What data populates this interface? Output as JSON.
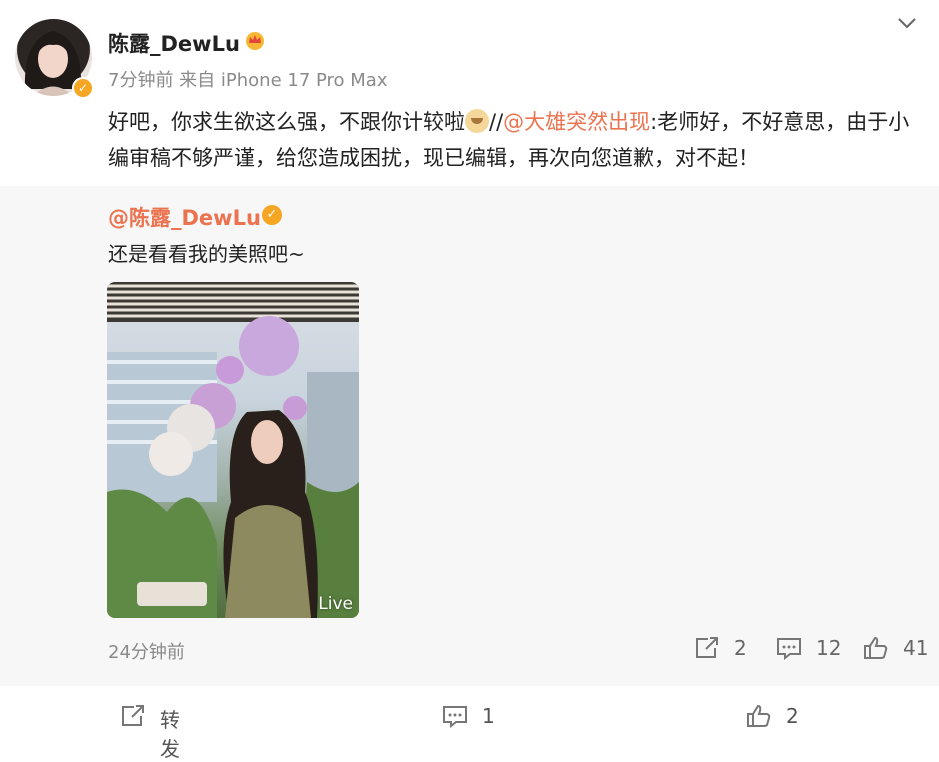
{
  "post": {
    "username": "陈露_DewLu",
    "meta": "7分钟前 来自 iPhone 17 Pro Max",
    "text_part1": "好吧，你求生欲这么强，不跟你计较啦",
    "text_part2": "//",
    "mention": "@大雄突然出现",
    "text_part3": ":老师好，不好意思，由于小编审稿不够严谨，给您造成困扰，现已编辑，再次向您道歉，对不起！"
  },
  "repost": {
    "author": "@陈露_DewLu",
    "text": "还是看看我的美照吧~",
    "live_label": "Live",
    "time": "24分钟前",
    "shares": "2",
    "comments": "12",
    "likes": "41"
  },
  "actions": {
    "forward_label": "转发",
    "comment_count": "1",
    "like_count": "2"
  },
  "colors": {
    "accent": "#eb7350",
    "verified": "#f5a623",
    "muted": "#8a8a8a"
  }
}
